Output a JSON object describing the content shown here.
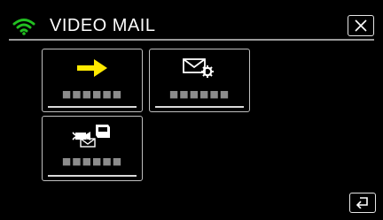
{
  "header": {
    "title": "VIDEO MAIL",
    "wifi_icon": "wifi-signal-icon",
    "close_icon": "close-icon"
  },
  "tiles": [
    {
      "icon": "arrow-right-icon",
      "label": "■■■■■■"
    },
    {
      "icon": "mail-settings-icon",
      "label": "■■■■■■"
    },
    {
      "icon": "camera-mail-icon",
      "label": "■■■■■■"
    }
  ],
  "footer": {
    "back_icon": "return-icon"
  },
  "colors": {
    "background": "#000000",
    "accent_yellow": "#ffea00",
    "wifi_green": "#22c021",
    "border": "#bfbfbf"
  }
}
